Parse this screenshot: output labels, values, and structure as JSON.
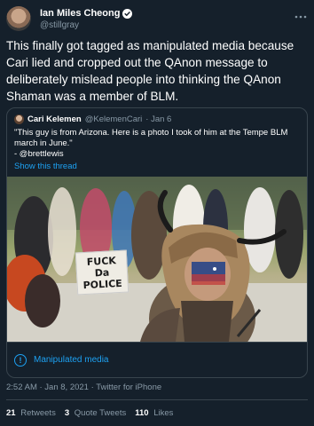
{
  "author": {
    "name": "Ian Miles Cheong",
    "handle": "@stillgray"
  },
  "tweet_text": "This finally got tagged as manipulated media because Cari lied and cropped out the QAnon message to deliberately mislead people into thinking the QAnon Shaman was a member of BLM.",
  "quote": {
    "name": "Cari Kelemen",
    "handle": "@KelemenCari",
    "date": "· Jan 6",
    "body": "\"This guy is from Arizona. Here is a photo I took of him at the Tempe BLM march in June.\"",
    "credit": "- @brettlewis",
    "show_thread": "Show this thread",
    "sign_line1": "FUCK",
    "sign_line2": "Da",
    "sign_line3": "POLICE"
  },
  "manipulated_label": "Manipulated media",
  "timestamp": "2:52 AM · Jan 8, 2021 · Twitter for iPhone",
  "stats": {
    "retweets_count": "21",
    "retweets_label": "Retweets",
    "quotes_count": "3",
    "quotes_label": "Quote Tweets",
    "likes_count": "110",
    "likes_label": "Likes"
  },
  "colors": {
    "background": "#15202b",
    "accent": "#1da1f2",
    "secondary_text": "#8899a6",
    "border": "#38444d"
  },
  "icons": [
    "verified-badge-icon",
    "more-options-icon",
    "info-icon"
  ]
}
